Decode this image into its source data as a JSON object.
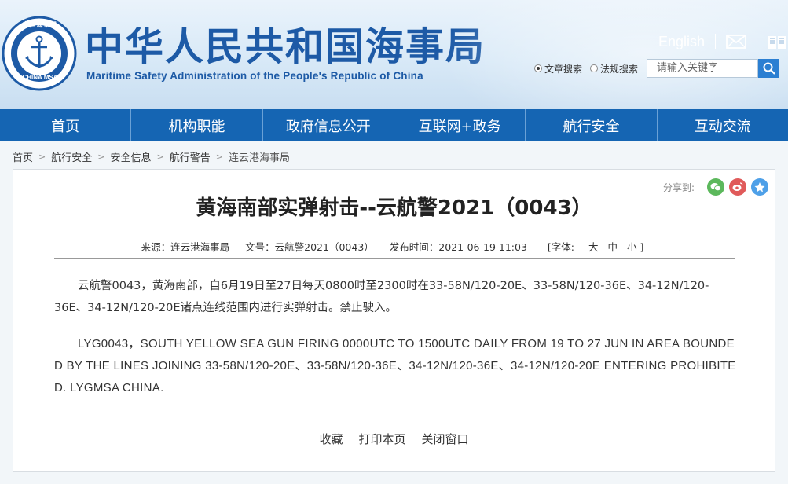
{
  "header": {
    "logo_text_top": "中国海事局",
    "logo_text_bottom": "CHINA MSA",
    "title_zh": "中华人民共和国海事局",
    "title_en": "Maritime Safety Administration of the People's Republic of China",
    "english_link": "English",
    "search": {
      "option_article": "文章搜索",
      "option_law": "法规搜索",
      "placeholder": "请输入关键字"
    }
  },
  "nav": {
    "items": [
      "首页",
      "机构职能",
      "政府信息公开",
      "互联网+政务",
      "航行安全",
      "互动交流"
    ]
  },
  "breadcrumb": [
    "首页",
    "航行安全",
    "安全信息",
    "航行警告",
    "连云港海事局"
  ],
  "article": {
    "share_label": "分享到:",
    "title": "黄海南部实弹射击--云航警2021（0043）",
    "source": "来源：连云港海事局",
    "doc_no": "文号：云航警2021（0043）",
    "publish_time": "发布时间：2021-06-19 11:03",
    "font_label": "[字体:",
    "font_large": "大",
    "font_medium": "中",
    "font_small": "小 ]",
    "para_zh": "云航警0043，黄海南部，自6月19日至27日每天0800时至2300时在33-58N/120-20E、33-58N/120-36E、34-12N/120-36E、34-12N/120-20E诸点连线范围内进行实弹射击。禁止驶入。",
    "para_en": "LYG0043，SOUTH YELLOW SEA GUN FIRING 0000UTC TO 1500UTC DAILY FROM 19 TO 27 JUN IN AREA BOUNDED BY THE LINES JOINING 33-58N/120-20E、33-58N/120-36E、34-12N/120-36E、34-12N/120-20E ENTERING PROHIBITED. LYGMSA CHINA.",
    "actions": [
      "收藏",
      "打印本页",
      "关闭窗口"
    ]
  },
  "colors": {
    "brand_blue": "#1d5aa6",
    "nav_blue": "#1565b3"
  }
}
